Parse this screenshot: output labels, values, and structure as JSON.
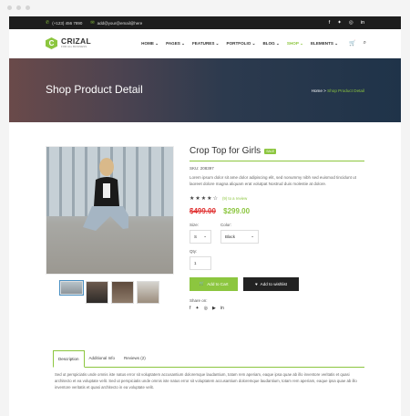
{
  "topbar": {
    "phone": "(+123) 456 7890",
    "email": "add@your@email@here",
    "social_icons": [
      "facebook-icon",
      "twitter-icon",
      "instagram-icon",
      "linkedin-icon"
    ]
  },
  "nav": {
    "logo_title": "CRIZAL",
    "logo_sub": "FOR ALL BUSINESS",
    "menu": [
      "HOME",
      "PAGES",
      "FEATURES",
      "PORTFOLIO",
      "BLOG",
      "SHOP",
      "ELEMENTS"
    ],
    "active_menu": "SHOP"
  },
  "hero": {
    "title": "Shop Product Detail",
    "breadcrumb_home": "Home",
    "breadcrumb_sep": ">",
    "breadcrumb_current": "Shop Product Detail"
  },
  "product": {
    "title": "Crop Top for Girls",
    "sale_badge": "SALE",
    "sku": "SKU: 208397",
    "description": "Lorem ipsum dolor sit ame dolor adipiscing elit, sed nonummy nibh sed euismod tincidunt ut laoreet dolore magna aliquam erat volutpat Nostrud duis molestie at dolore.",
    "rating": 4.5,
    "reviews_link": "(9) to a review",
    "old_price": "$499.00",
    "new_price": "$299.00",
    "size_label": "Size:",
    "size_value": "S",
    "color_label": "Color:",
    "color_value": "Black",
    "qty_label": "Qty:",
    "qty_value": "1",
    "add_to_cart": "Add to Cart",
    "add_to_wishlist": "Add to wishlist",
    "share_label": "Share on:"
  },
  "tabs": [
    "Description",
    "Additional Info",
    "Reviews (2)"
  ],
  "tab_text": "Sed ut perspiciatis unde omnis iste natus error sit voluptatem accusantium doloremque laudantium, totam rem aperiam, eaque ipsa quae ab illo inventore veritatis et quasi architecto et ea voluptate velit. Sed ut perspiciatis unde omnis iste natus error sit voluptatem accusantium doloremque laudantium, totam rem aperiam, eaque ipsa quae ab illo inventore veritatis et quasi architecto in ea voluptate velit.",
  "colors": {
    "accent": "#8cc63f",
    "price_old": "#e03131",
    "dark": "#1d1d1d"
  }
}
